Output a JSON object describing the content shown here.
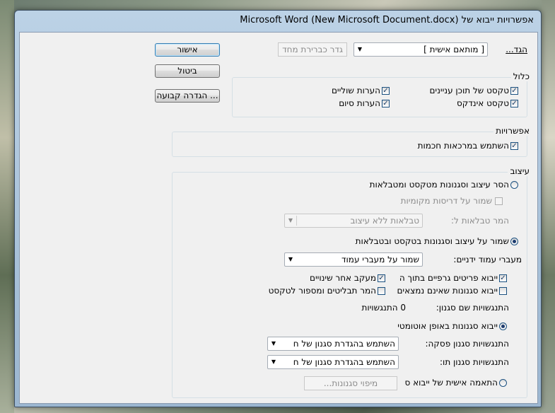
{
  "window": {
    "title": "אפשרויות ייבוא של Microsoft Word (New Microsoft Document.docx)"
  },
  "buttons": {
    "ok": "אישור",
    "cancel": "ביטול",
    "set_default": "הגדרה קבועה ..."
  },
  "preset": {
    "label": "הגד...",
    "value": "[ מותאם אישית ]",
    "set_as_default": "גדר כברירת מחד"
  },
  "include": {
    "title": "כלול",
    "items": [
      {
        "label": "טקסט של תוכן עניינים",
        "checked": true
      },
      {
        "label": "הערות שוליים",
        "checked": true
      },
      {
        "label": "טקסט אינדקס",
        "checked": true
      },
      {
        "label": "הערות סיום",
        "checked": true
      }
    ]
  },
  "options": {
    "title": "אפשרויות",
    "smart_quotes": {
      "label": "השתמש במרכאות חכמות",
      "checked": true
    }
  },
  "formatting": {
    "title": "עיצוב",
    "remove_styles": {
      "label": "הסר עיצוב וסגנונות מטקסט ומטבלאות",
      "selected": false
    },
    "keep_local_overrides": {
      "label": "שמור על דריסות מקומיות",
      "checked": false
    },
    "convert_tables_label": "המר טבלאות ל:",
    "convert_tables_value": "טבלאות ללא עיצוב",
    "keep_styles": {
      "label": "שמור על עיצוב וסגנונות בטקסט ובטבלאות",
      "selected": true
    },
    "manual_page_breaks_label": "מעברי עמוד ידניים:",
    "manual_page_breaks_value": "שמור על מעברי עמוד",
    "import_inline_graphics": {
      "label": "ייבוא פריטים גרפיים בתוך ה",
      "checked": true
    },
    "track_changes": {
      "label": "מעקב אחר שינויים",
      "checked": true
    },
    "import_unused_styles": {
      "label": "ייבוא סגנונות שאינם נמצאים",
      "checked": false
    },
    "convert_bullets": {
      "label": "המר תבליטים ומספור לטקסט",
      "checked": false
    },
    "style_conflicts_label": "התנגשויות שם סגנון:",
    "style_conflicts_value": "0 התנגשויות",
    "auto_import": {
      "label": "ייבוא סגנונות באופן אוטומטי",
      "selected": true
    },
    "paragraph_conflicts_label": "התנגשויות סגנון פסקה:",
    "paragraph_conflicts_value": "השתמש בהגדרת סגנון של ח",
    "character_conflicts_label": "התנגשויות סגנון תו:",
    "character_conflicts_value": "השתמש בהגדרת סגנון של ח",
    "customize_import": {
      "label": "התאמה אישית של ייבוא ס",
      "selected": false
    },
    "style_mapping": "מיפוי סגנונות..."
  }
}
